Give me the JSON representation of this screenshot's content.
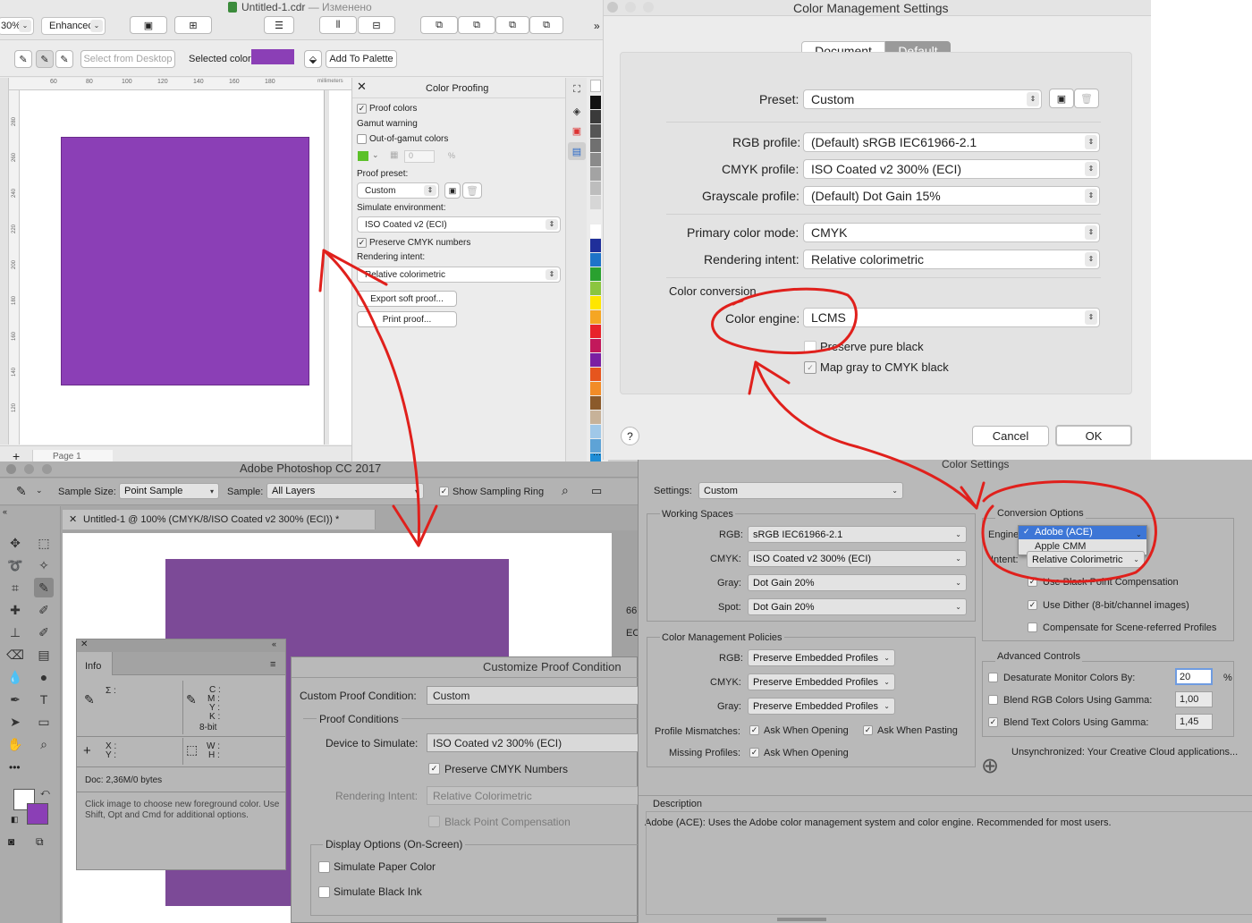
{
  "corel": {
    "zoom": "30%",
    "view": "Enhanced",
    "title": "Untitled-1.cdr",
    "title_status": "— Изменено",
    "select_desktop": "Select from Desktop",
    "selected_color_label": "Selected color",
    "add_palette": "Add To Palette",
    "ruler_unit": "millimeters",
    "ruler_top": [
      "60",
      "80",
      "100",
      "120",
      "140",
      "160",
      "180"
    ],
    "ruler_left": [
      "280",
      "260",
      "240",
      "220",
      "200",
      "180",
      "160",
      "140",
      "120"
    ],
    "page_label": "Page 1",
    "swatch_color": "#8b3fb6",
    "palette": [
      "#111111",
      "#3a3a3a",
      "#555555",
      "#707070",
      "#8a8a8a",
      "#a3a3a3",
      "#bdbdbd",
      "#d6d6d6",
      "#ededed",
      "#ffffff",
      "#1f2f9a",
      "#1e73c8",
      "#2aa12f",
      "#8bc53f",
      "#ffe600",
      "#f5a623",
      "#e8232b",
      "#c2185b",
      "#7b1fa2",
      "#e6551e",
      "#f28c28",
      "#8b5a2b",
      "#c7b299",
      "#a0c8e8",
      "#5ea3d6",
      "#1f8dd6"
    ]
  },
  "proofing": {
    "title": "Color Proofing",
    "proof_colors": "Proof colors",
    "gamut_warning": "Gamut warning",
    "out_of_gamut": "Out-of-gamut colors",
    "gamut_value": "0",
    "gamut_unit": "%",
    "proof_preset_label": "Proof preset:",
    "proof_preset": "Custom",
    "simulate_label": "Simulate environment:",
    "simulate": "ISO Coated v2 (ECI)",
    "preserve_cmyk": "Preserve CMYK numbers",
    "rendering_label": "Rendering intent:",
    "rendering": "Relative colorimetric",
    "export": "Export soft proof...",
    "print": "Print proof..."
  },
  "cms": {
    "title": "Color Management Settings",
    "tabs": [
      "Document",
      "Default"
    ],
    "preset_label": "Preset:",
    "preset": "Custom",
    "rgb_label": "RGB profile:",
    "rgb": "(Default) sRGB IEC61966-2.1",
    "cmyk_label": "CMYK profile:",
    "cmyk": "ISO Coated v2 300% (ECI)",
    "gray_label": "Grayscale profile:",
    "gray": "(Default) Dot Gain 15%",
    "primary_label": "Primary color mode:",
    "primary": "CMYK",
    "intent_label": "Rendering intent:",
    "intent": "Relative colorimetric",
    "conversion_label": "Color conversion",
    "engine_label": "Color engine:",
    "engine": "LCMS",
    "preserve_black": "Preserve pure black",
    "map_gray": "Map gray to CMYK black",
    "help": "?",
    "cancel": "Cancel",
    "ok": "OK"
  },
  "photoshop": {
    "title": "Adobe Photoshop CC 2017",
    "sample_size_label": "Sample Size:",
    "sample_size": "Point Sample",
    "sample_label": "Sample:",
    "sample": "All Layers",
    "sampling_ring": "Show Sampling Ring",
    "doc_tab": "Untitled-1 @ 100% (CMYK/8/ISO Coated v2 300% (ECI)) *",
    "canvas_color": "#7c4a97",
    "partial_a": "66",
    "partial_b": "EC"
  },
  "info": {
    "title": "Info",
    "sigma": "Σ :",
    "cmyk_letters": [
      "C :",
      "M :",
      "Y :",
      "K :"
    ],
    "bit": "8-bit",
    "xy": [
      "X :",
      "Y :"
    ],
    "wh": [
      "W :",
      "H :"
    ],
    "doc": "Doc: 2,36M/0 bytes",
    "hint": "Click image to choose new foreground color. Use Shift, Opt and Cmd for additional options."
  },
  "proof_condition": {
    "title": "Customize Proof Condition",
    "custom_label": "Custom Proof Condition:",
    "custom": "Custom",
    "conditions": "Proof Conditions",
    "device_label": "Device to Simulate:",
    "device": "ISO Coated v2 300% (ECI)",
    "preserve": "Preserve CMYK Numbers",
    "intent_label": "Rendering Intent:",
    "intent": "Relative Colorimetric",
    "bpc": "Black Point Compensation",
    "display": "Display Options (On-Screen)",
    "paper": "Simulate Paper Color",
    "ink": "Simulate Black Ink"
  },
  "color_settings": {
    "title": "Color Settings",
    "settings_label": "Settings:",
    "settings": "Custom",
    "working": "Working Spaces",
    "rgb_label": "RGB:",
    "rgb": "sRGB IEC61966-2.1",
    "cmyk_label": "CMYK:",
    "cmyk": "ISO Coated v2 300% (ECI)",
    "gray_label": "Gray:",
    "gray": "Dot Gain 20%",
    "spot_label": "Spot:",
    "spot": "Dot Gain 20%",
    "policies": "Color Management Policies",
    "p_rgb": "Preserve Embedded Profiles",
    "p_cmyk": "Preserve Embedded Profiles",
    "p_gray": "Preserve Embedded Profiles",
    "mismatch_label": "Profile Mismatches:",
    "ask_open": "Ask When Opening",
    "ask_paste": "Ask When Pasting",
    "missing_label": "Missing Profiles:",
    "ask_open2": "Ask When Opening",
    "conversion": "Conversion Options",
    "engine_label": "Engine:",
    "engine_options": [
      "Adobe (ACE)",
      "Apple CMM"
    ],
    "intent_label": "Intent:",
    "intent": "Relative Colorimetric",
    "use_bpc": "Use Black Point Compensation",
    "use_dither": "Use Dither (8-bit/channel images)",
    "scene": "Compensate for Scene-referred Profiles",
    "advanced": "Advanced Controls",
    "desat": "Desaturate Monitor Colors By:",
    "desat_val": "20",
    "desat_unit": "%",
    "blend_rgb": "Blend RGB Colors Using Gamma:",
    "blend_rgb_val": "1,00",
    "blend_text": "Blend Text Colors Using Gamma:",
    "blend_text_val": "1,45",
    "unsync": "Unsynchronized: Your Creative Cloud applications...",
    "desc_title": "Description",
    "desc": "Adobe (ACE):  Uses the Adobe color management system and color engine.  Recommended for most users."
  },
  "annotation_color": "#e0201c"
}
